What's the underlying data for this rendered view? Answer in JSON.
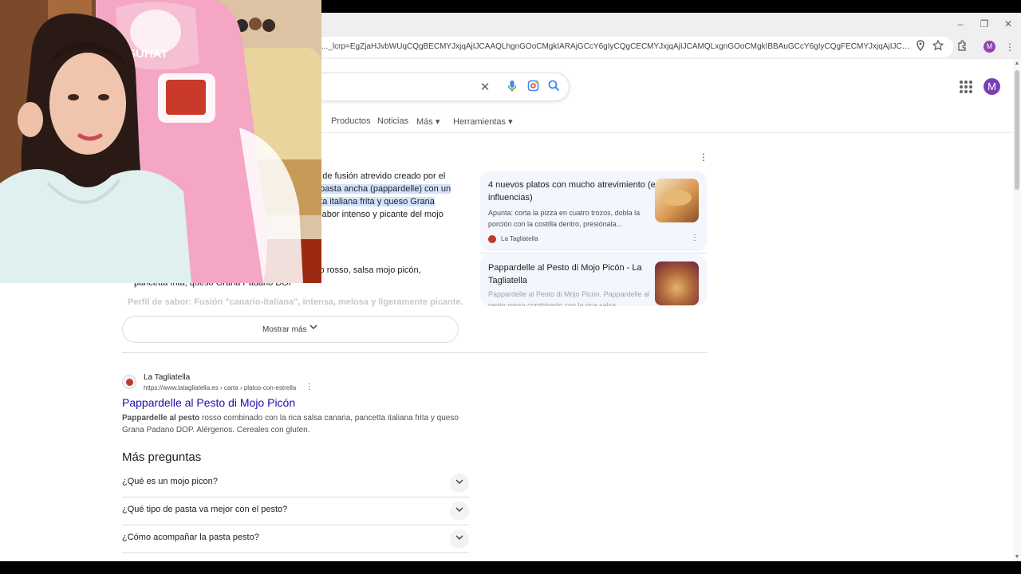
{
  "browser": {
    "url": "..._lcrp=EgZjaHJvbWUqCQgBECMYJxjqAjIJCAAQLhgnGOoCMgkIARAjGCcY6gIyCQgCECMYJxjqAjIJCAMQLxgnGOoCMgkIBBAuGCcY6gIyCQgFECMYJxjqAjIJCAYQLxgnGOoCMgkIBxA...",
    "profile_initial": "M",
    "window_controls": [
      "–",
      "❐",
      "✕"
    ]
  },
  "search": {
    "clear_glyph": "✕"
  },
  "header": {
    "account_initial": "M"
  },
  "nav": {
    "tabs": [
      {
        "label": "Productos"
      },
      {
        "label": "Noticias"
      },
      {
        "label": "Más ▾"
      },
      {
        "label": "Herramientas ▾"
      }
    ]
  },
  "overview": {
    "lines": [
      {
        "pre": "",
        "hl": "",
        "post": "to de fusión atrevido creado por el"
      },
      {
        "pre": "",
        "hl": "n pasta ancha (pappardelle) con un",
        "post": ""
      },
      {
        "pre": "",
        "hl": "etta italiana frita y queso Grana",
        "post": ""
      },
      {
        "pre": "",
        "hl": "",
        "post": ", sabor intenso y picante del mojo"
      },
      {
        "pre": "",
        "hl": "",
        "post": "sto rosso, salsa mojo picón,"
      },
      {
        "pre": "",
        "hl": "",
        "post": "pancetta frita, queso Grana Padano DOP"
      }
    ],
    "faded_line": "Perfil de sabor: Fusión \"canario-italiana\", intensa, melosa y ligeramente picante.",
    "menu_glyph": "⋮",
    "show_more": "Mostrar más"
  },
  "side_cards": [
    {
      "title": "4 nuevos platos con mucho atrevimiento (e influencias)",
      "snippet": "Apunta: corta la pizza en cuatro trozos, dobla la porción con la costilla dentro, presiónala...",
      "source": "La Tagliatella"
    },
    {
      "title": "Pappardelle al Pesto di Mojo Picón - La Tagliatella",
      "snippet": "Pappardelle al Pesto di Mojo Picón. Pappardelle al pesto rosso combinado con la rica salsa..."
    }
  ],
  "result": {
    "site": "La Tagliatella",
    "url": "https://www.latagliatella.es › carta › platos-con-estrella",
    "title": "Pappardelle al Pesto di Mojo Picón",
    "desc_bold": "Pappardelle al pesto",
    "desc_rest": " rosso combinado con la rica salsa canaria, pancetta italiana frita y queso Grana Padano DOP. Alérgenos. Cereales con gluten."
  },
  "paa": {
    "heading": "Más preguntas",
    "questions": [
      "¿Qué es un mojo picon?",
      "¿Qué tipo de pasta va mejor con el pesto?",
      "¿Cómo acompañar la pasta pesto?"
    ]
  },
  "webcam": {
    "chair_brand": "SUHAT"
  },
  "colors": {
    "link": "#1a0dab",
    "highlight": "#d3e3fd",
    "avatar": "#7b3fb8",
    "chair_pink": "#f4a6c4"
  }
}
